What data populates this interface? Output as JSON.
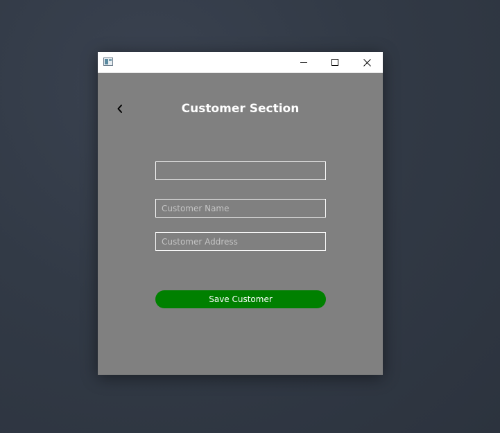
{
  "window": {
    "controls": {
      "minimize_icon": "minimize-icon",
      "maximize_icon": "maximize-icon",
      "close_icon": "close-icon"
    }
  },
  "header": {
    "back_icon": "chevron-left-icon",
    "title": "Customer Section"
  },
  "form": {
    "id_field": {
      "value": "",
      "placeholder": ""
    },
    "name_field": {
      "value": "",
      "placeholder": "Customer Name"
    },
    "address_field": {
      "value": "",
      "placeholder": "Customer Address"
    },
    "save_label": "Save Customer"
  },
  "colors": {
    "page_background": "#808080",
    "save_button": "#008000",
    "text": "#ffffff",
    "titlebar": "#ffffff"
  }
}
